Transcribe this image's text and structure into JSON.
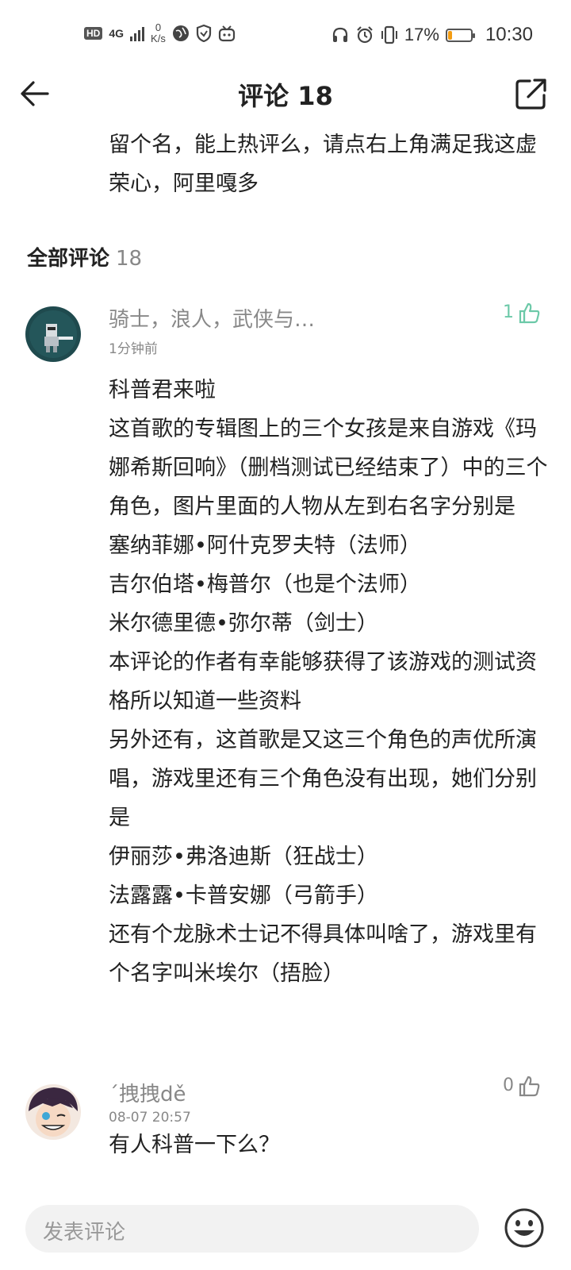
{
  "status_bar": {
    "hd": "HD",
    "net": "4G",
    "speed_value": "0",
    "speed_unit": "K/s",
    "battery": "17%",
    "battery_level": 0.17,
    "time": "10:30"
  },
  "header": {
    "title": "评论 18"
  },
  "intro_text": "留个名，能上热评么，请点右上角满足我这虚荣心，阿里嘎多",
  "section": {
    "label": "全部评论",
    "count": "18"
  },
  "comments": [
    {
      "username": "骑士，浪人，武侠与…",
      "time": "1分钟前",
      "likes": "1",
      "liked": true,
      "body": "科普君来啦\n这首歌的专辑图上的三个女孩是来自游戏《玛娜希斯回响》（删档测试已经结束了）中的三个角色，图片里面的人物从左到右名字分别是\n塞纳菲娜•阿什克罗夫特（法师）\n吉尔伯塔•梅普尔（也是个法师）\n米尔德里德•弥尔蒂（剑士）\n本评论的作者有幸能够获得了该游戏的测试资格所以知道一些资料\n另外还有，这首歌是又这三个角色的声优所演唱，游戏里还有三个角色没有出现，她们分别是\n伊丽莎•弗洛迪斯（狂战士）\n法露露•卡普安娜（弓箭手）\n还有个龙脉术士记不得具体叫啥了，游戏里有个名字叫米埃尔（捂脸）"
    },
    {
      "username": "´拽拽dě",
      "time": "08-07 20:57",
      "likes": "0",
      "liked": false,
      "body": "有人科普一下么？"
    }
  ],
  "input": {
    "placeholder": "发表评论"
  },
  "colors": {
    "liked": "#6cc9a8",
    "muted": "#888888",
    "battery": "#f39c12"
  }
}
